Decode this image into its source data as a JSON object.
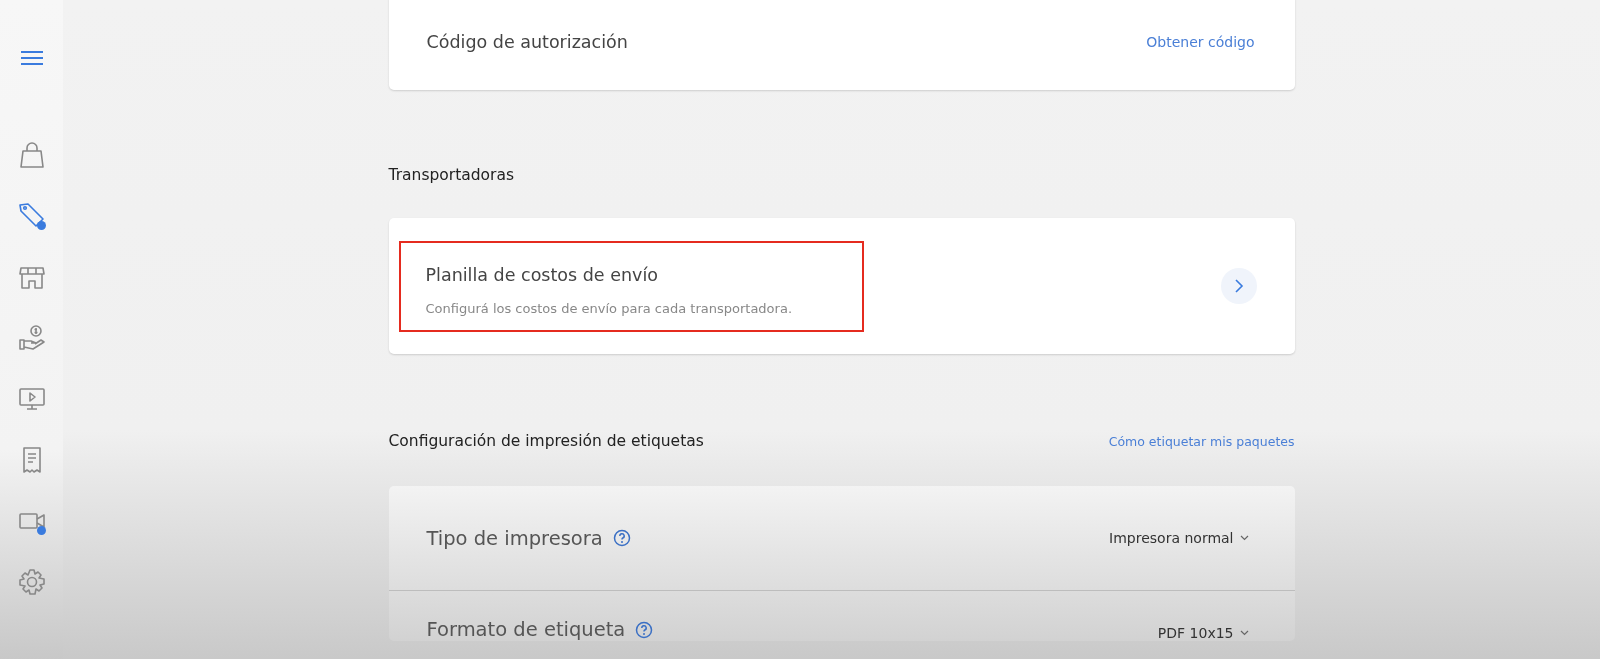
{
  "sidebar": {
    "items": [
      {
        "selected": false,
        "dot": false
      },
      {
        "selected": true,
        "dot": true
      },
      {
        "selected": false,
        "dot": false
      },
      {
        "selected": false,
        "dot": false
      },
      {
        "selected": false,
        "dot": false
      },
      {
        "selected": false,
        "dot": false
      },
      {
        "selected": false,
        "dot": true
      },
      {
        "selected": false,
        "dot": false
      }
    ]
  },
  "auth_card": {
    "label": "Código de autorización",
    "link": "Obtener código"
  },
  "carriers": {
    "heading": "Transportadoras",
    "card": {
      "title": "Planilla de costos de envío",
      "description": "Configurá los costos de envío para cada transportadora.",
      "highlighted": true
    }
  },
  "labels": {
    "heading": "Configuración de impresión de etiquetas",
    "link": "Cómo etiquetar mis paquetes",
    "rows": [
      {
        "label": "Tipo de impresora",
        "value": "Impresora normal"
      },
      {
        "label": "Formato de etiqueta",
        "value": "PDF 10x15"
      }
    ]
  }
}
